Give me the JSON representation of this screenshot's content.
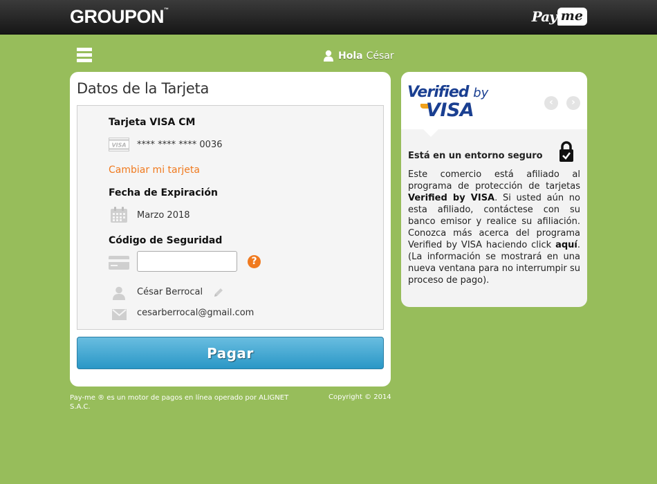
{
  "header": {
    "groupon_logo": "GROUPON",
    "groupon_tm": "™",
    "payme_pay": "Pay",
    "payme_me": "me"
  },
  "nav": {
    "menu_icon": "hamburger-icon",
    "greeting_bold": "Hola",
    "greeting_name": "César"
  },
  "card_form": {
    "title": "Datos de la Tarjeta",
    "card_label": "Tarjeta VISA CM",
    "card_brand_icon": "VISA",
    "card_number": "**** **** **** 0036",
    "change_card_link": "Cambiar mi tarjeta",
    "expiry_label": "Fecha de Expiración",
    "expiry_value": "Marzo 2018",
    "security_label": "Código de Seguridad",
    "security_value": "",
    "help_symbol": "?",
    "holder_name": "César Berrocal",
    "email": "cesarberrocal@gmail.com",
    "pay_button": "Pagar"
  },
  "footer": {
    "left_text": "Pay-me ® es un motor de pagos en línea operado por ALIGNET S.A.C.",
    "right_text": "Copyright © 2014"
  },
  "info_panel": {
    "brand_verified": "Verified",
    "brand_by": "by",
    "brand_visa": "VISA",
    "prev_symbol": "‹",
    "next_symbol": "›",
    "secure_title": "Está en un entorno seguro",
    "text_part1": "Este comercio está afiliado al programa de protección de tarjetas ",
    "text_bold1": "Verified by VISA",
    "text_part2": ". Si usted aún no esta afiliado, contáctese con su banco emisor y realice su afiliación. Conozca más acerca del programa Verified by VISA haciendo click ",
    "text_bold2": "aquí",
    "text_part3": ". (La información se mostrará en una nueva ventana para no interrumpir su proceso de pago)."
  },
  "colors": {
    "background": "#97bd5b",
    "accent_orange": "#f07a1f",
    "button_blue": "#3aa3d1",
    "visa_blue": "#1a3f91"
  }
}
